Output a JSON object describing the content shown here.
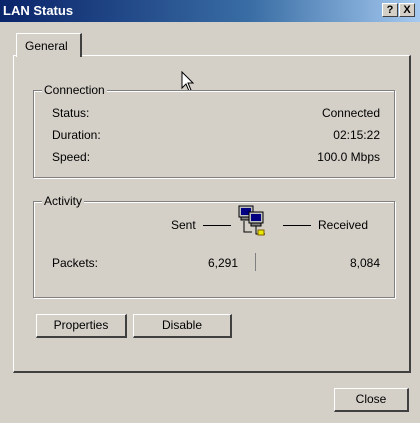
{
  "window": {
    "title": "LAN Status",
    "help_label": "?",
    "close_label": "X"
  },
  "tabs": [
    {
      "label": "General",
      "selected": true
    }
  ],
  "connection": {
    "legend": "Connection",
    "rows": [
      {
        "label": "Status:",
        "value": "Connected"
      },
      {
        "label": "Duration:",
        "value": "02:15:22"
      },
      {
        "label": "Speed:",
        "value": "100.0 Mbps"
      }
    ]
  },
  "activity": {
    "legend": "Activity",
    "sent_label": "Sent",
    "received_label": "Received",
    "packets_label": "Packets:",
    "packets_sent": "6,291",
    "packets_received": "8,084"
  },
  "buttons": {
    "properties": "Properties",
    "disable": "Disable",
    "close": "Close"
  },
  "colors": {
    "titlebar_start": "#0a246a",
    "titlebar_end": "#a6caf0",
    "face": "#d4d0c8",
    "network_light": "#e8e800"
  }
}
